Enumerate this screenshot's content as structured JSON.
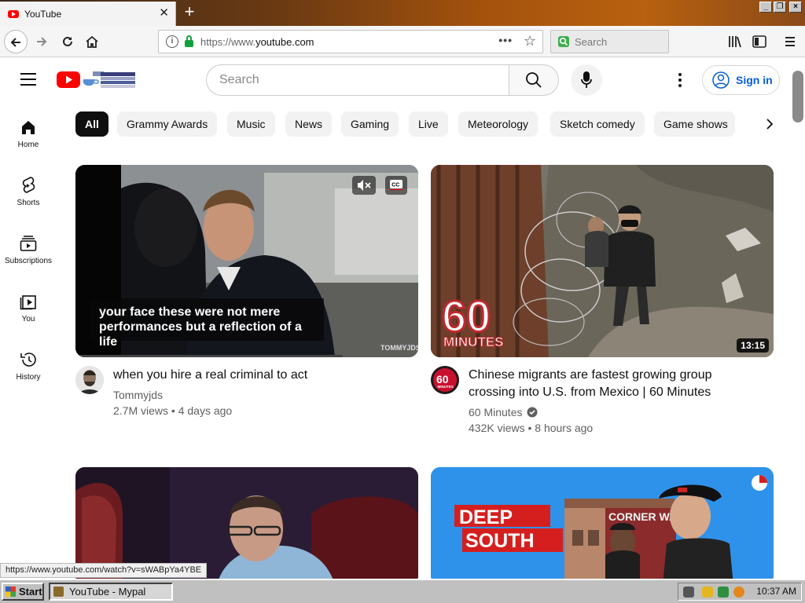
{
  "browser": {
    "tab_title": "YouTube",
    "tab_close": "✕",
    "new_tab": "+",
    "url_prefix": "https://www.",
    "url_domain": "youtube.com",
    "search_placeholder": "Search",
    "status_link": "https://www.youtube.com/watch?v=sWABpYa4YBE"
  },
  "header": {
    "search_placeholder": "Search",
    "sign_in": "Sign in"
  },
  "sidebar": [
    {
      "label": "Home",
      "icon": "home-icon"
    },
    {
      "label": "Shorts",
      "icon": "shorts-icon"
    },
    {
      "label": "Subscriptions",
      "icon": "subscriptions-icon"
    },
    {
      "label": "You",
      "icon": "you-icon"
    },
    {
      "label": "History",
      "icon": "history-icon"
    }
  ],
  "chips": [
    "All",
    "Grammy Awards",
    "Music",
    "News",
    "Gaming",
    "Live",
    "Meteorology",
    "Sketch comedy",
    "Game shows"
  ],
  "videos": [
    {
      "title": "when you hire a real criminal to act",
      "channel": "Tommyjds",
      "meta": "2.7M views • 4 days ago",
      "caption_line1": "your face these were not mere",
      "caption_line2": "performances but a reflection of a life",
      "watermark": "TOMMYJDS"
    },
    {
      "title_line1": "Chinese migrants are fastest growing group",
      "title_line2": "crossing into U.S. from Mexico | 60 Minutes",
      "channel": "60 Minutes",
      "meta": "432K views • 8 hours ago",
      "duration": "13:15",
      "logo_big": "60",
      "logo_word": "MINUTES"
    },
    {
      "title": ""
    },
    {
      "badge_line1": "DEEP",
      "badge_line2": "SOUTH",
      "sign_text": "CORNER WA"
    }
  ],
  "taskbar": {
    "start": "Start",
    "task": "YouTube - Mypal",
    "clock": "10:37 AM"
  }
}
